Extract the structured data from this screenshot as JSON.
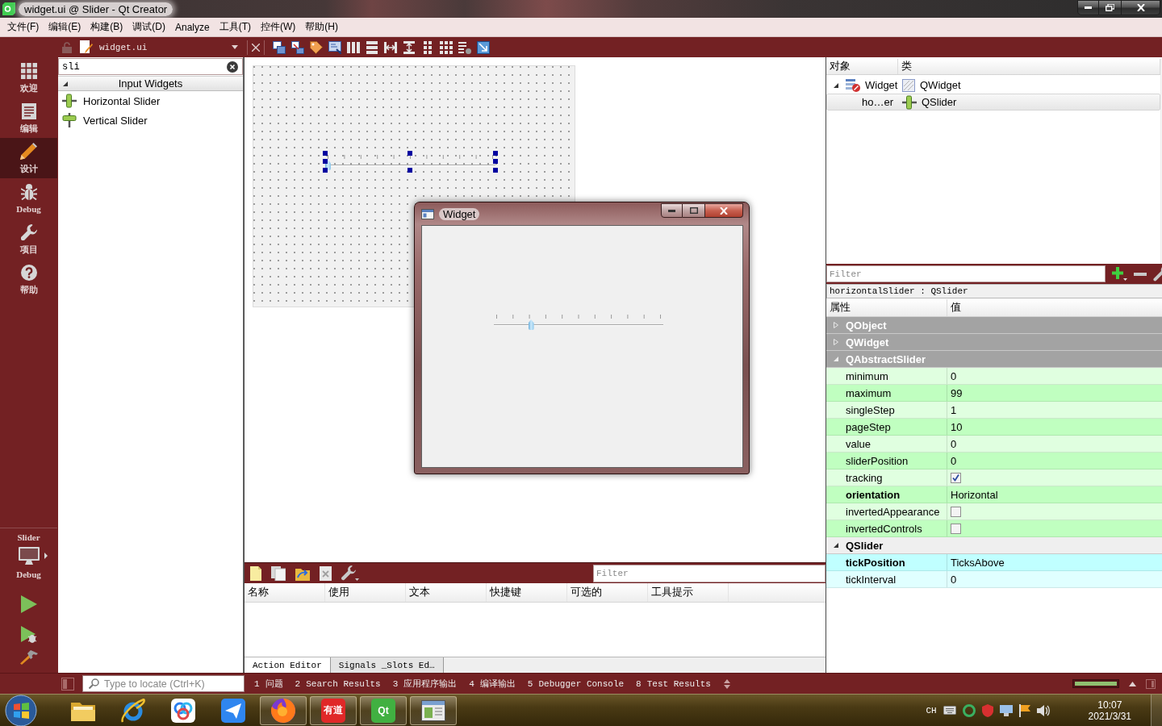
{
  "window": {
    "title": "widget.ui @ Slider - Qt Creator"
  },
  "menu": [
    "文件(F)",
    "编辑(E)",
    "构建(B)",
    "调试(D)",
    "Analyze",
    "工具(T)",
    "控件(W)",
    "帮助(H)"
  ],
  "mode_bar": {
    "modes": [
      {
        "kind": "welcome",
        "label": "欢迎",
        "selected": false
      },
      {
        "kind": "edit",
        "label": "编辑",
        "selected": false
      },
      {
        "kind": "design",
        "label": "设计",
        "selected": true
      },
      {
        "kind": "debug",
        "label": "Debug",
        "selected": false
      },
      {
        "kind": "projects",
        "label": "项目",
        "selected": false
      },
      {
        "kind": "help",
        "label": "帮助",
        "selected": false
      }
    ],
    "project": "Slider",
    "build_config": "Debug"
  },
  "editor_toolbar": {
    "document": "widget.ui"
  },
  "widget_box": {
    "filter": "sli",
    "category": {
      "label": "Input Widgets",
      "expanded": true
    },
    "items": [
      {
        "kind": "horizontal",
        "label": "Horizontal Slider"
      },
      {
        "kind": "vertical",
        "label": "Vertical Slider"
      }
    ]
  },
  "form": {
    "slider": {
      "level": 0,
      "selected": true
    }
  },
  "preview": {
    "title": "Widget",
    "slider": {
      "level": 0.21
    }
  },
  "action_editor": {
    "filter_placeholder": "Filter",
    "columns": [
      "名称",
      "使用",
      "文本",
      "快捷键",
      "可选的",
      "工具提示"
    ],
    "tabs": [
      {
        "label": "Action Editor",
        "selected": true
      },
      {
        "label": "Signals _Slots Ed…",
        "selected": false
      }
    ]
  },
  "object_inspector": {
    "columns": [
      "对象",
      "类"
    ],
    "tree": [
      {
        "name": "Widget",
        "class": "QWidget",
        "kind": "form",
        "expanded": true,
        "selected": false,
        "children": [
          {
            "name": "ho…er",
            "class": "QSlider",
            "kind": "slider",
            "selected": true
          }
        ]
      }
    ]
  },
  "property_editor": {
    "filter_placeholder": "Filter",
    "object": "horizontalSlider : QSlider",
    "columns": [
      "属性",
      "值"
    ],
    "groups": [
      {
        "name": "QObject",
        "kind": "dark",
        "expanded": false
      },
      {
        "name": "QWidget",
        "kind": "dark",
        "expanded": false
      },
      {
        "name": "QAbstractSlider",
        "kind": "dark",
        "expanded": true,
        "color": "#c0ffc0",
        "properties": [
          {
            "name": "minimum",
            "kind": "text",
            "value": "0",
            "changed": false
          },
          {
            "name": "maximum",
            "kind": "text",
            "value": "99",
            "changed": false
          },
          {
            "name": "singleStep",
            "kind": "text",
            "value": "1",
            "changed": false
          },
          {
            "name": "pageStep",
            "kind": "text",
            "value": "10",
            "changed": false
          },
          {
            "name": "value",
            "kind": "text",
            "value": "0",
            "changed": false
          },
          {
            "name": "sliderPosition",
            "kind": "text",
            "value": "0",
            "changed": false
          },
          {
            "name": "tracking",
            "kind": "checkbox",
            "checked": true,
            "changed": false
          },
          {
            "name": "orientation",
            "kind": "text",
            "value": "Horizontal",
            "changed": true
          },
          {
            "name": "invertedAppearance",
            "kind": "checkbox",
            "checked": false,
            "changed": false
          },
          {
            "name": "invertedControls",
            "kind": "checkbox",
            "checked": false,
            "changed": false
          }
        ]
      },
      {
        "name": "QSlider",
        "kind": "light",
        "expanded": true,
        "color": "#c0ffff",
        "properties": [
          {
            "name": "tickPosition",
            "kind": "text",
            "value": "TicksAbove",
            "changed": true
          },
          {
            "name": "tickInterval",
            "kind": "text",
            "value": "0",
            "changed": false
          }
        ]
      }
    ]
  },
  "status_bar": {
    "locate_placeholder": "Type to locate (Ctrl+K)",
    "panes": [
      {
        "number": "1",
        "label": "问题"
      },
      {
        "number": "2",
        "label": "Search Results"
      },
      {
        "number": "3",
        "label": "应用程序输出"
      },
      {
        "number": "4",
        "label": "编译输出"
      },
      {
        "number": "5",
        "label": "Debugger Console"
      },
      {
        "number": "8",
        "label": "Test Results"
      }
    ],
    "progress": {
      "level": 1
    }
  },
  "taskbar": {
    "apps": [
      {
        "kind": "explorer",
        "running": false
      },
      {
        "kind": "browser",
        "running": false
      },
      {
        "kind": "netdisk",
        "running": false
      },
      {
        "kind": "messenger",
        "running": false
      },
      {
        "kind": "firefox",
        "running": true
      },
      {
        "kind": "youdao",
        "text": "有道",
        "running": true
      },
      {
        "kind": "qt",
        "text": "Qt",
        "running": true
      },
      {
        "kind": "window",
        "running": true
      }
    ],
    "language": "CH",
    "time": "10:07",
    "date": "2021/3/31"
  }
}
